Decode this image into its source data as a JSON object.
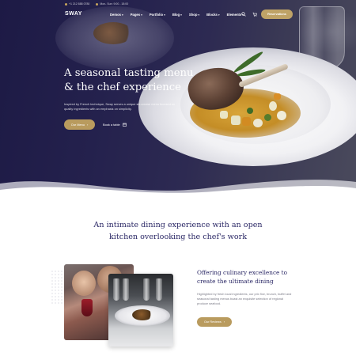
{
  "nav": {
    "logo": "SWAY",
    "phone": "+1 212 888 0780",
    "hours": "Mon- Sun: 9:00 - 18:00",
    "items": [
      {
        "label": "Demos",
        "has_dropdown": true
      },
      {
        "label": "Pages",
        "has_dropdown": true
      },
      {
        "label": "Portfolio",
        "has_dropdown": true
      },
      {
        "label": "Blog",
        "has_dropdown": true
      },
      {
        "label": "Shop",
        "has_dropdown": true
      },
      {
        "label": "Blocks",
        "has_dropdown": true
      },
      {
        "label": "Elements",
        "has_dropdown": true
      }
    ],
    "reservations_label": "Reservations"
  },
  "hero": {
    "title": "A seasonal tasting menu & the chef experience",
    "description": "Inspired by French technique, Sway serves a unique six-course menu focused on quality ingredients with an emphasis on simplicity.",
    "primary_button": "Our Menu",
    "secondary_button": "Book a table"
  },
  "intro": {
    "heading": "An intimate dining experience with an open kitchen overlooking the chef's work"
  },
  "feature": {
    "heading": "Offering culinary excellence to create the ultimate dining",
    "body": "Highlighted by fresh local ingredients, our prix fixe, brunch, buffet and seasonal tasting menus boast an exquisite selection of regional produce seafood.",
    "button": "Our Reviews"
  },
  "colors": {
    "accent": "#b99b5e",
    "navy": "#2a2765",
    "hero_bg": "#24214d"
  },
  "icons": [
    "phone-icon",
    "clock-icon",
    "search-icon",
    "cart-icon",
    "arrow-right-icon",
    "calendar-icon"
  ]
}
